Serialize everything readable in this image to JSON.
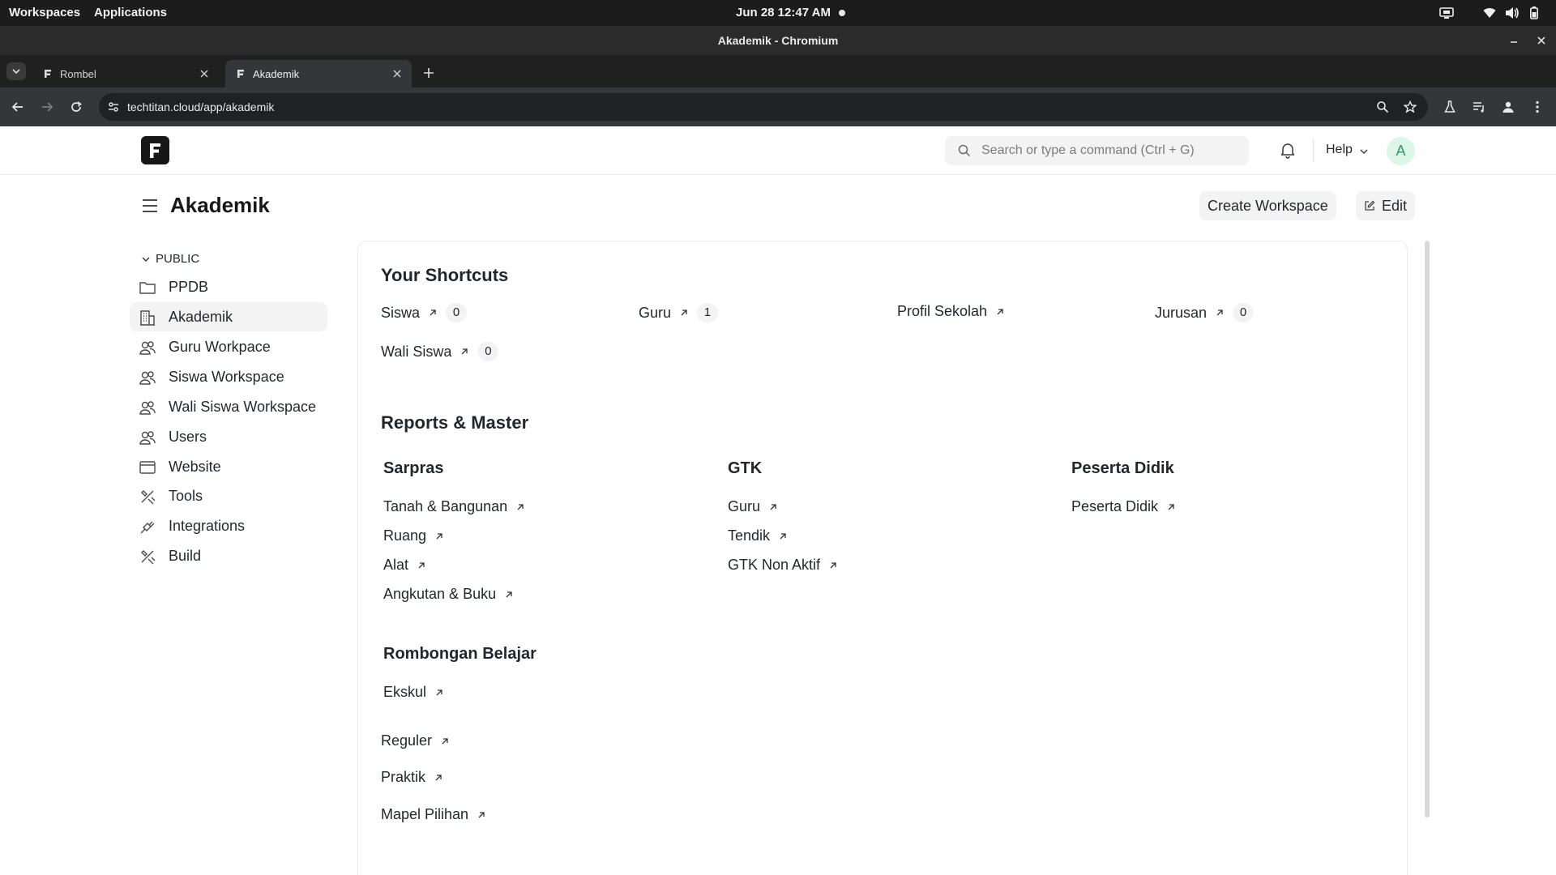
{
  "os": {
    "workspaces": "Workspaces",
    "applications": "Applications",
    "clock": "Jun 28  12:47 AM"
  },
  "browser": {
    "window_title": "Akademik - Chromium",
    "tabs": [
      {
        "label": "Rombel"
      },
      {
        "label": "Akademik"
      }
    ],
    "url": "techtitan.cloud/app/akademik"
  },
  "navbar": {
    "search_placeholder": "Search or type a command (Ctrl + G)",
    "help_label": "Help",
    "avatar_letter": "A"
  },
  "page": {
    "title": "Akademik",
    "create_workspace_label": "Create Workspace",
    "edit_label": "Edit"
  },
  "sidebar": {
    "section": "PUBLIC",
    "items": [
      {
        "label": "PPDB",
        "icon": "folder-icon"
      },
      {
        "label": "Akademik",
        "icon": "building-icon",
        "active": true
      },
      {
        "label": "Guru Workpace",
        "icon": "users-icon"
      },
      {
        "label": "Siswa Workspace",
        "icon": "users-icon"
      },
      {
        "label": "Wali Siswa Workspace",
        "icon": "users-icon"
      },
      {
        "label": "Users",
        "icon": "users-icon"
      },
      {
        "label": "Website",
        "icon": "browser-icon"
      },
      {
        "label": "Tools",
        "icon": "tools-icon"
      },
      {
        "label": "Integrations",
        "icon": "plug-icon"
      },
      {
        "label": "Build",
        "icon": "tools-icon"
      }
    ]
  },
  "shortcuts": {
    "heading": "Your Shortcuts",
    "items": [
      {
        "label": "Siswa",
        "count": "0"
      },
      {
        "label": "Guru",
        "count": "1"
      },
      {
        "label": "Profil Sekolah",
        "count": ""
      },
      {
        "label": "Jurusan",
        "count": "0"
      },
      {
        "label": "Wali Siswa",
        "count": "0"
      }
    ]
  },
  "reports": {
    "heading": "Reports & Master",
    "groups": [
      {
        "title": "Sarpras",
        "links": [
          "Tanah & Bangunan",
          "Ruang",
          "Alat",
          "Angkutan & Buku"
        ]
      },
      {
        "title": "GTK",
        "links": [
          "Guru",
          "Tendik",
          "GTK Non Aktif"
        ]
      },
      {
        "title": "Peserta Didik",
        "links": [
          "Peserta Didik"
        ]
      },
      {
        "title": "Rombongan Belajar",
        "links": [
          "Ekskul"
        ]
      }
    ],
    "extra_links": [
      "Reguler",
      "Praktik",
      "Mapel Pilihan"
    ]
  },
  "colors": {
    "accent": "#171717",
    "avatar_bg": "#dcf7e6",
    "avatar_fg": "#2c9b5b",
    "sidebar_active": "#f3f3f3"
  }
}
